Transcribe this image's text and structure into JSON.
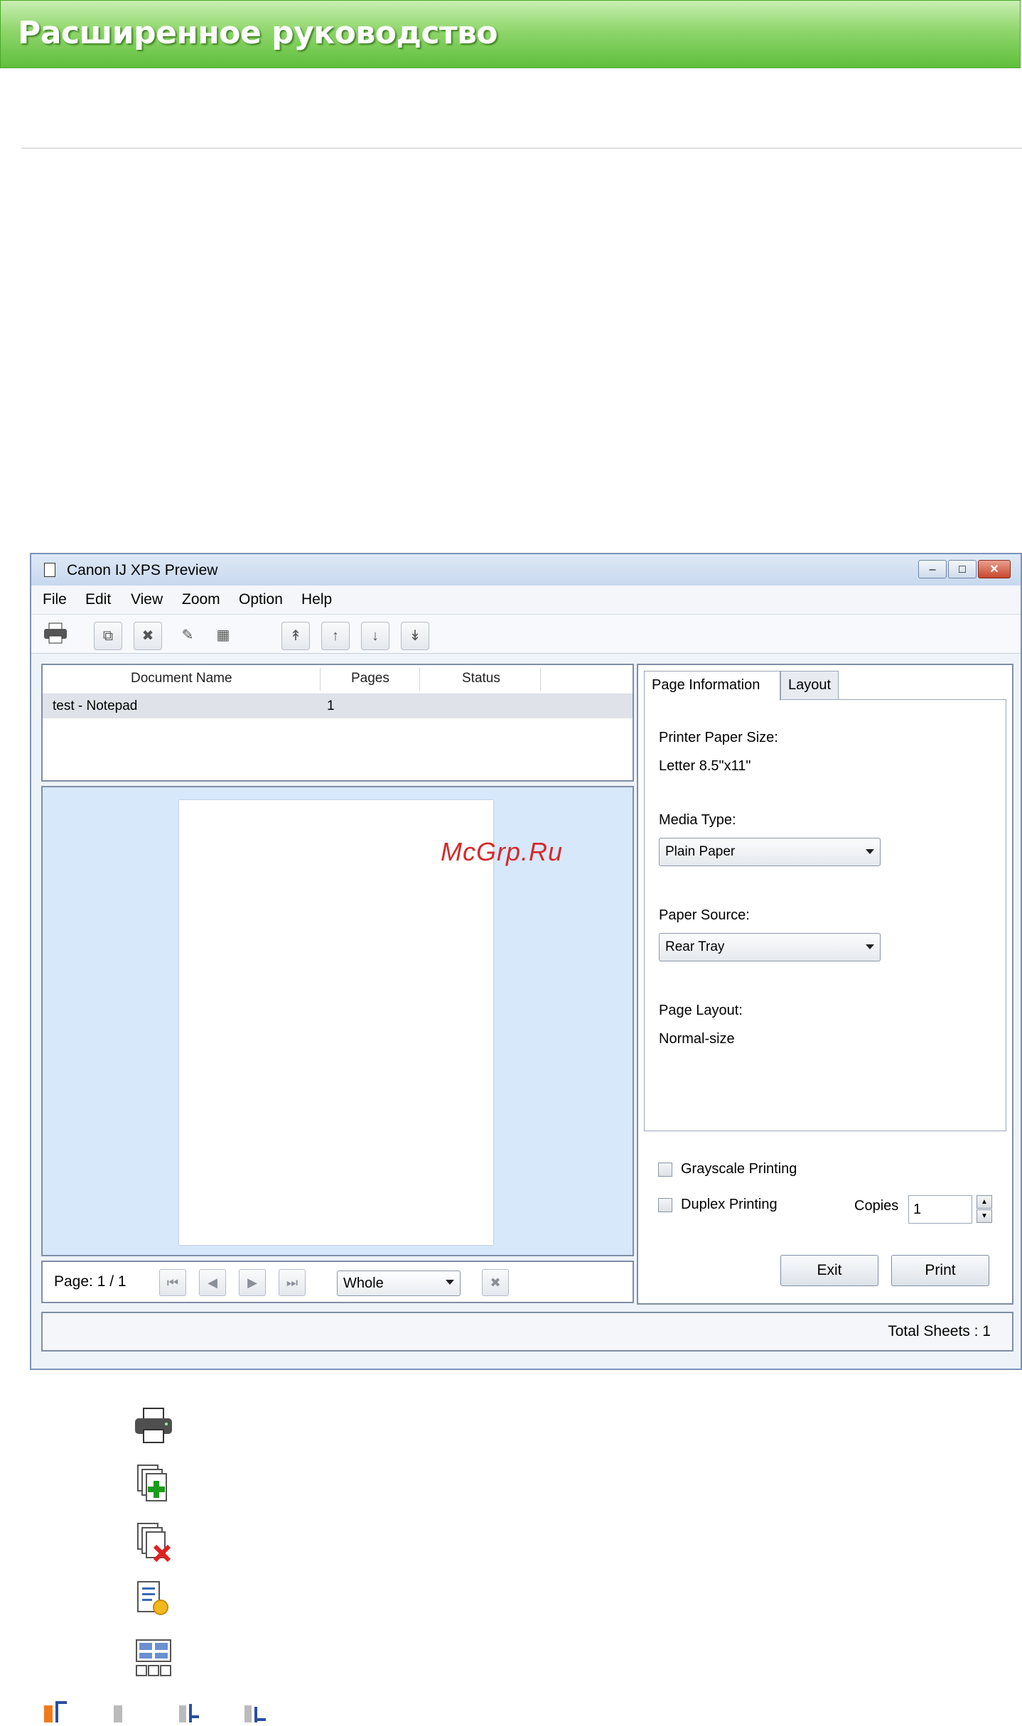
{
  "header": {
    "title": "Расширенное руководство"
  },
  "window": {
    "title": "Canon IJ XPS Preview",
    "menu": [
      "File",
      "Edit",
      "View",
      "Zoom",
      "Option",
      "Help"
    ],
    "doc_list": {
      "columns": [
        "Document Name",
        "Pages",
        "Status"
      ],
      "rows": [
        {
          "name": "test - Notepad",
          "pages": "1",
          "status": ""
        }
      ]
    },
    "page_nav": {
      "page_label": "Page: 1 / 1",
      "zoom_value": "Whole"
    },
    "tabs": [
      "Page Information",
      "Layout"
    ],
    "page_info": {
      "paper_size_label": "Printer Paper Size:",
      "paper_size_value": "Letter 8.5\"x11\"",
      "media_type_label": "Media Type:",
      "media_type_value": "Plain Paper",
      "paper_source_label": "Paper Source:",
      "paper_source_value": "Rear Tray",
      "page_layout_label": "Page Layout:",
      "page_layout_value": "Normal-size"
    },
    "options": {
      "grayscale_label": "Grayscale Printing",
      "duplex_label": "Duplex Printing",
      "copies_label": "Copies",
      "copies_value": "1"
    },
    "buttons": {
      "exit": "Exit",
      "print": "Print"
    },
    "status": {
      "total_sheets": "Total Sheets : 1"
    }
  },
  "watermark": "McGrp.Ru",
  "legend_icons": [
    "print-icon",
    "add-document-icon",
    "delete-document-icon",
    "reset-document-icon",
    "view-thumbnails-icon"
  ],
  "colors": {
    "banner_green": "#5fbf3c",
    "preview_blue": "#d7e8fa",
    "watermark_red": "#d42a2a"
  }
}
